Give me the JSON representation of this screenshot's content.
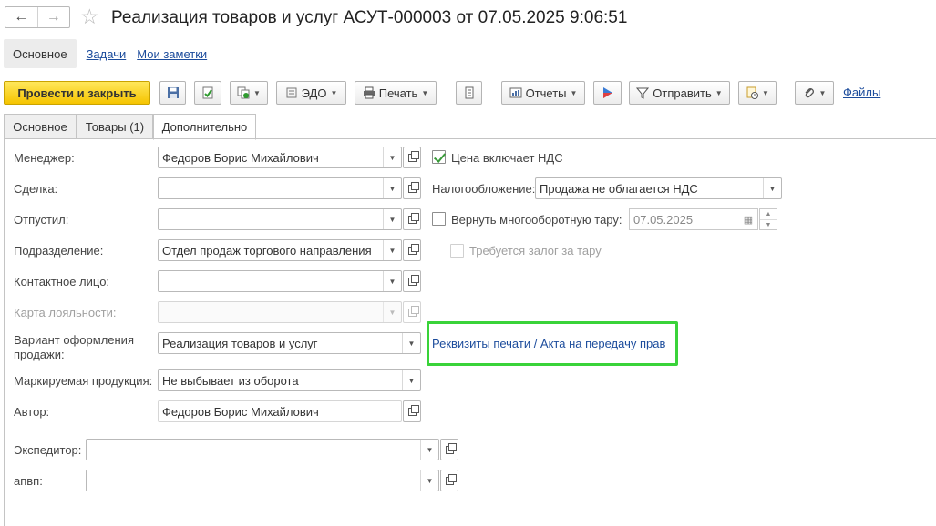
{
  "window": {
    "title": "Реализация товаров и услуг АСУТ-000003 от 07.05.2025 9:06:51",
    "back_icon": "arrow-left-icon",
    "forward_icon": "arrow-right-icon",
    "favorite_icon": "star-icon"
  },
  "nav": {
    "main": "Основное",
    "tasks": "Задачи",
    "notes": "Мои заметки"
  },
  "toolbar": {
    "post_close": "Провести и закрыть",
    "edo": "ЭДО",
    "print": "Печать",
    "reports": "Отчеты",
    "send": "Отправить",
    "files": "Файлы"
  },
  "tabs": {
    "main": "Основное",
    "goods": "Товары (1)",
    "extra": "Дополнительно"
  },
  "form": {
    "manager_label": "Менеджер:",
    "manager_value": "Федоров Борис Михайлович",
    "deal_label": "Сделка:",
    "deal_value": "",
    "released_label": "Отпустил:",
    "released_value": "",
    "department_label": "Подразделение:",
    "department_value": "Отдел продаж торгового направления",
    "contact_label": "Контактное лицо:",
    "contact_value": "",
    "loyalty_label": "Карта лояльности:",
    "loyalty_value": "",
    "variant_label_line1": "Вариант оформления",
    "variant_label_line2": "продажи:",
    "variant_value": "Реализация товаров и услуг",
    "marked_label": "Маркируемая продукция:",
    "marked_value": "Не выбывает из оборота",
    "author_label": "Автор:",
    "author_value": "Федоров Борис Михайлович",
    "forwarder_label": "Экспедитор:",
    "forwarder_value": "",
    "apvp_label": "апвп:",
    "apvp_value": ""
  },
  "right": {
    "price_vat_label": "Цена включает НДС",
    "price_vat_checked": true,
    "taxation_label": "Налогообложение:",
    "taxation_value": "Продажа не облагается НДС",
    "return_tare_label": "Вернуть многооборотную тару:",
    "return_tare_checked": false,
    "return_tare_date": "07.05.2025",
    "deposit_label": "Требуется залог за тару",
    "deposit_checked": false,
    "print_requisites_link": "Реквизиты печати / Акта на передачу прав"
  },
  "colors": {
    "primary_button": "#f5c400",
    "link": "#1c4c9c",
    "highlight": "#39d339"
  }
}
